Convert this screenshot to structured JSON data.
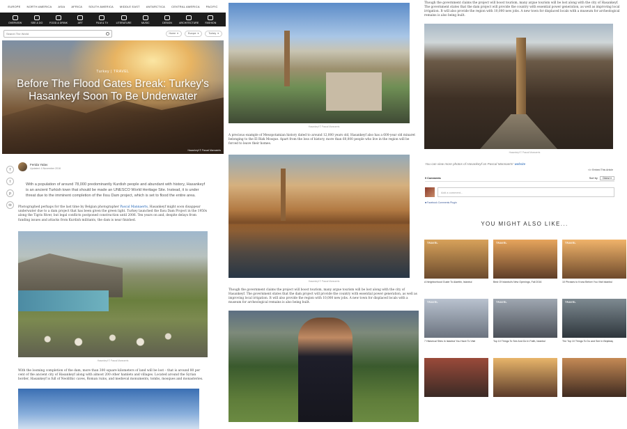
{
  "topnav": [
    "EUROPE",
    "NORTH AMERICA",
    "ASIA",
    "AFRICA",
    "SOUTH AMERICA",
    "MIDDLE EAST",
    "ANTARCTICA",
    "CENTRAL AMERICA",
    "PACIFIC"
  ],
  "categories": [
    {
      "label": "OVERVIEW",
      "icon": "eye-icon"
    },
    {
      "label": "SEE & DO",
      "icon": "eye-icon"
    },
    {
      "label": "FOOD & DRINK",
      "icon": "cutlery-icon"
    },
    {
      "label": "ART",
      "icon": "palette-icon"
    },
    {
      "label": "FILM & TV",
      "icon": "film-icon"
    },
    {
      "label": "LITERATURE",
      "icon": "book-icon"
    },
    {
      "label": "MUSIC",
      "icon": "music-icon"
    },
    {
      "label": "DESIGN",
      "icon": "design-icon"
    },
    {
      "label": "ARCHITECTURE",
      "icon": "building-icon"
    },
    {
      "label": "FASHION",
      "icon": "hanger-icon"
    }
  ],
  "search": {
    "placeholder": "Search The World"
  },
  "pills": {
    "home": "Home",
    "europe": "Europe",
    "turkey": "Turkey"
  },
  "hero": {
    "kicker": "Turkey | TRAVEL",
    "title": "Before The Flood Gates Break: Turkey's Hasankeyf Soon To Be Underwater",
    "credit": "Hasankeyf © Pascal Mannaerts"
  },
  "author": {
    "name": "Ferida Yalav",
    "date": "Updated: 4 November 2016"
  },
  "share": [
    "f",
    "t",
    "p",
    "✉"
  ],
  "lead": "With a population of around 78,000 predominantly Kurdish people and abundant with history, Hasankeyf is an ancient Turkish town that should be made an UNESCO World Heritage Site. Instead, it is under threat due to the imminent completion of the Ilısu Dam project, which is set to flood the entire area.",
  "body1": {
    "pre": "Photographed perhaps for the last time by Belgian photographer ",
    "link": "Pascal Mannaerts",
    "post": ", Hasankeyf might soon disappear underwater due to a dam project that has been given the green light. Turkey launched the Ilısu Dam Project in the 1950s along the Tigris River, but legal conflicts postponed construction until 2006. Ten years on and, despite delays from funding issues and attacks from Kurdish militants, the dam is near finished."
  },
  "captions": {
    "c1a": "Hasankeyf © Pascal Mannaerts",
    "c2a": "Hasankeyf © Pascal Mannaerts",
    "c2b": "Hasankeyf © Pascal Mannaerts",
    "c3a": "Hasankeyf © Pascal Mannaerts"
  },
  "body2": "With the looming completion of the dam, more than 300 square kilometers of land will be lost – that is around 80 per cent of the ancient city of Hasankeyf along with almost 200 other hamlets and villages. Located around the Syrian border, Hasankeyf is full of Neolithic caves, Roman ruins, and medieval monuments, tombs, mosques and monasteries.",
  "col2": {
    "text1": "A precious example of Mesopotamian history dated to around 12,000 years old, Hasankeyf also has a 600-year old minaret belonging to the El Rizk Mosque. Apart from the loss of history, more than 60,000 people who live in the region will be forced to leave their homes.",
    "text2": "Though the government claims the project will boost tourism, many argue tourism will be lost along with the city of Hasankeyf. The government states that the dam project will provide the country with essential power generation, as well as improving local irrigation. It will also provide the region with 10,000 new jobs. A new town for displaced locals with a museum for archeological remains is also being built."
  },
  "col3": {
    "top_text": "Though the government claims the project will boost tourism, many argue tourism will be lost along with the city of Hasankeyf. The government states that the dam project will provide the country with essential power generation, as well as improving local irrigation. It will also provide the region with 10,000 new jobs. A new town for displaced locals with a museum for archeological remains is also being built.",
    "more_pre": "You can view more photos of Hasankeyf on Pascal Mannaerts' ",
    "more_link": "website",
    "embed": "Embed This Article",
    "comments_count": "0 Comments",
    "sort_label": "Sort by",
    "sort_value": "Oldest",
    "comment_placeholder": "Add a comment...",
    "fb_plugin": "Facebook Comments Plugin",
    "ymal": "YOU MIGHT ALSO LIKE..."
  },
  "cards": [
    {
      "tag": "TRAVEL",
      "title": "A Neighborhood Guide To Alaettin, Istanbul",
      "c1": "#d8a25a",
      "c2": "#6b4b2e"
    },
    {
      "tag": "TRAVEL",
      "title": "Best Of Istanbul's New Openings, Fall 2016",
      "c1": "#e7a55c",
      "c2": "#5e3d28"
    },
    {
      "tag": "TRAVEL",
      "title": "10 Phrases to Know Before You Visit Istanbul",
      "c1": "#f0b36a",
      "c2": "#6e4a2c"
    },
    {
      "tag": "TRAVEL",
      "title": "7 Historical Sites In Istanbul You Have To Visit",
      "c1": "#b9c2cf",
      "c2": "#6b737f"
    },
    {
      "tag": "TRAVEL",
      "title": "Top 10 Things To See And Do In Fatih, Istanbul",
      "c1": "#9fa7b1",
      "c2": "#4b5058"
    },
    {
      "tag": "TRAVEL",
      "title": "The Top 10 Things To Do and See In Beşiktaş",
      "c1": "#7e8a91",
      "c2": "#2e363c"
    },
    {
      "tag": "",
      "title": "",
      "c1": "#9a4a3a",
      "c2": "#3a2a25"
    },
    {
      "tag": "",
      "title": "",
      "c1": "#e8b56a",
      "c2": "#5a3a2a"
    },
    {
      "tag": "",
      "title": "",
      "c1": "#c58a55",
      "c2": "#3e2a20"
    }
  ]
}
